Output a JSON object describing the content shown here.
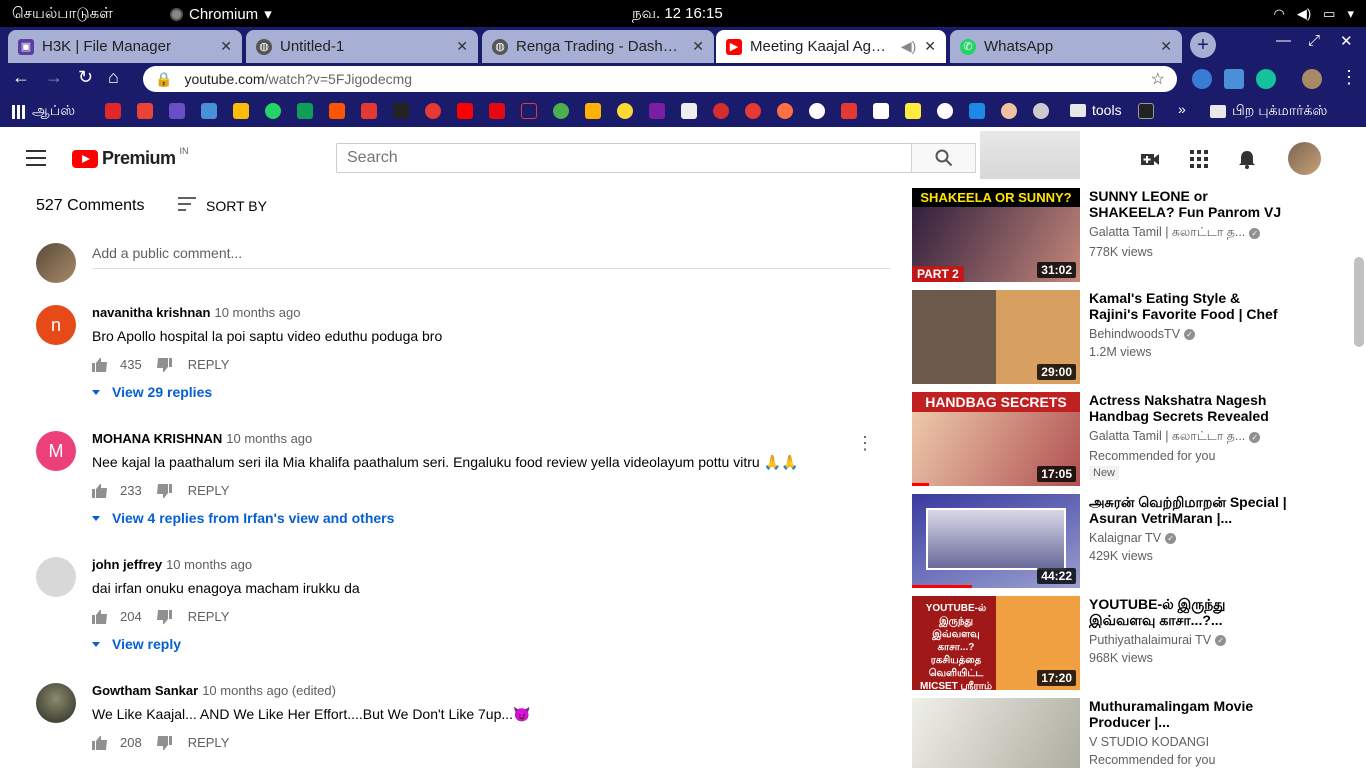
{
  "os": {
    "activities": "செயல்பாடுகள்",
    "app": "Chromium",
    "clock": "நவ. 12  16:15"
  },
  "tabs": [
    {
      "title": "H3K | File Manager",
      "color": "#5b3fa0"
    },
    {
      "title": "Untitled-1",
      "color": "#555555"
    },
    {
      "title": "Renga Trading - Dashboard",
      "color": "#555555"
    },
    {
      "title": "Meeting Kaajal Agarwal",
      "color": "#ff0000"
    },
    {
      "title": "WhatsApp",
      "color": "#25d366"
    }
  ],
  "omnibox": {
    "host": "youtube.com",
    "path": "/watch?v=5FJigodecmg"
  },
  "bookmarks": {
    "apps": "ஆப்ஸ்",
    "tools": "tools",
    "other": "பிற புக்மார்க்ஸ்"
  },
  "yt": {
    "brand": "Premium",
    "country": "IN",
    "search_placeholder": "Search"
  },
  "comments_header": {
    "count": "527 Comments",
    "sort": "SORT BY",
    "add_placeholder": "Add a public comment..."
  },
  "comments": [
    {
      "author": "navanitha krishnan",
      "time": "10 months ago",
      "text": "Bro Apollo hospital la poi saptu video eduthu poduga bro",
      "likes": "435",
      "reply": "REPLY",
      "replies": "View 29 replies",
      "avatar_letter": "n",
      "avatar_color": "#e64a19"
    },
    {
      "author": "MOHANA KRISHNAN",
      "time": "10 months ago",
      "text": "Nee kajal la paathalum seri ila Mia khalifa paathalum seri. Engaluku food review yella videolayum pottu vitru 🙏🙏",
      "likes": "233",
      "reply": "REPLY",
      "replies": "View 4 replies from Irfan's view and others",
      "avatar_letter": "M",
      "avatar_color": "#ec407a"
    },
    {
      "author": "john jeffrey",
      "time": "10 months ago",
      "text": "dai irfan onuku enagoya macham irukku da",
      "likes": "204",
      "reply": "REPLY",
      "replies": "View reply",
      "avatar_letter": "",
      "avatar_color": "#cfcfcf"
    },
    {
      "author": "Gowtham Sankar",
      "time": "10 months ago (edited)",
      "text": "We Like Kaajal... AND We Like Her Effort....But We Don't Like 7up...😈",
      "likes": "208",
      "reply": "REPLY",
      "replies": "",
      "avatar_letter": "",
      "avatar_color": "#3a3a2a"
    }
  ],
  "videos": [
    {
      "title": "SUNNY LEONE or SHAKEELA? Fun Panrom VJ SIDDHU Open...",
      "channel": "Galatta Tamil | கலாட்டா த...",
      "meta": "778K views",
      "duration": "31:02",
      "thumb_text": "SHAKEELA OR SUNNY?",
      "thumb_sub": "PART 2",
      "c1": "#2a1a3a",
      "c2": "#c4887a",
      "progress": 0,
      "verified": true,
      "badge": ""
    },
    {
      "title": "Kamal's Eating Style & Rajini's Favorite Food | Chef Venkates...",
      "channel": "BehindwoodsTV",
      "meta": "1.2M views",
      "duration": "29:00",
      "thumb_text": "",
      "thumb_sub": "",
      "c1": "#6b5a4a",
      "c2": "#d8a060",
      "progress": 0,
      "verified": true,
      "badge": ""
    },
    {
      "title": "Actress Nakshatra Nagesh Handbag Secrets Revealed by...",
      "channel": "Galatta Tamil | கலாட்டா த...",
      "meta": "Recommended for you",
      "duration": "17:05",
      "thumb_text": "HANDBAG SECRETS",
      "thumb_sub": "",
      "c1": "#c02020",
      "c2": "#f0d0b0",
      "progress": 0.1,
      "verified": true,
      "badge": "New"
    },
    {
      "title": "அசுரன் வெற்றிமாறன் Special | Asuran VetriMaran |...",
      "channel": "Kalaignar TV",
      "meta": "429K views",
      "duration": "44:22",
      "thumb_text": "",
      "thumb_sub": "",
      "c1": "#3a3aa0",
      "c2": "#9aa0d0",
      "progress": 0.36,
      "verified": true,
      "badge": ""
    },
    {
      "title": "YOUTUBE-ல் இருந்து இவ்வளவு காசா...?...",
      "channel": "Puthiyathalaimurai TV",
      "meta": "968K views",
      "duration": "17:20",
      "thumb_text": "YOUTUBE-ல் இருந்து இவ்வளவு காசா...? ரகசியத்தை வெளியிட்ட MICSET ஸ்ரீராம்",
      "thumb_sub": "",
      "c1": "#a01818",
      "c2": "#f0a040",
      "progress": 0,
      "verified": true,
      "badge": ""
    },
    {
      "title": "Muthuramalingam Movie Producer |...",
      "channel": "V STUDIO KODANGI",
      "meta": "Recommended for you",
      "duration": "",
      "thumb_text": "",
      "thumb_sub": "",
      "c1": "#c8c8c0",
      "c2": "#f0f0ea",
      "progress": 0,
      "verified": false,
      "badge": ""
    }
  ]
}
